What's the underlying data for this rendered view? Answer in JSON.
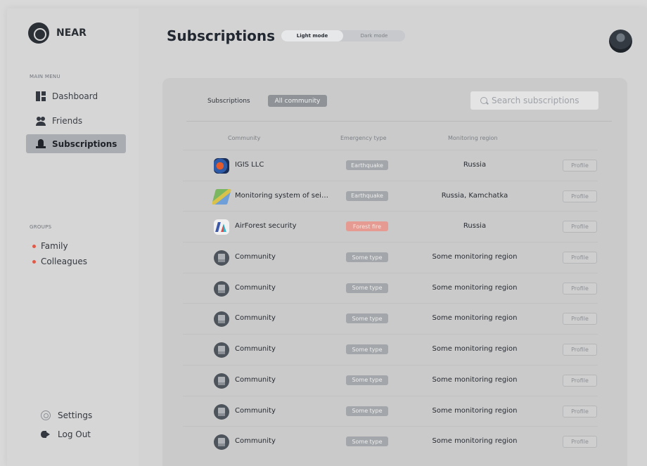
{
  "sidebar": {
    "logo_text": "NEAR",
    "main_menu_heading": "MAIN MENU",
    "menu": [
      {
        "label": "Dashboard",
        "icon": "dashboard-icon"
      },
      {
        "label": "Friends",
        "icon": "friends-icon"
      },
      {
        "label": "Subscriptions",
        "icon": "subscriptions-icon",
        "active": true
      }
    ],
    "groups_heading": "GROUPS",
    "groups": [
      {
        "label": "Family",
        "color": "#e05a47"
      },
      {
        "label": "Colleagues",
        "color": "#e05a47"
      }
    ],
    "settings_label": "Settings",
    "logout_label": "Log Out"
  },
  "header": {
    "title": "Subscriptions",
    "mode_light": "Light mode",
    "mode_dark": "Dark mode",
    "active_mode": "Light mode"
  },
  "panel": {
    "filter_label": "Subscriptions",
    "filter_chip": "All community",
    "search_placeholder": "Search subscriptions",
    "columns": {
      "community": "Community",
      "emergency_type": "Emergency type",
      "monitoring_region": "Monitoring region"
    },
    "rows": [
      {
        "name": "IGIS LLC",
        "type": "Earthquake",
        "region": "Russia",
        "button": "Profile",
        "icon": "igis-logo-icon"
      },
      {
        "name": "Monitoring system of seis...",
        "type": "Earthquake",
        "region": "Russia, Kamchatka",
        "button": "Profile",
        "icon": "seismic-map-icon"
      },
      {
        "name": "AirForest security",
        "type": "Forest fire",
        "region": "Russia",
        "button": "Profile",
        "icon": "airforest-logo-icon"
      },
      {
        "name": "Community",
        "type": "Some type",
        "region": "Some monitoring region",
        "button": "Profile",
        "icon": "community-icon"
      },
      {
        "name": "Community",
        "type": "Some type",
        "region": "Some monitoring region",
        "button": "Profile",
        "icon": "community-icon"
      },
      {
        "name": "Community",
        "type": "Some type",
        "region": "Some monitoring region",
        "button": "Profile",
        "icon": "community-icon"
      },
      {
        "name": "Community",
        "type": "Some type",
        "region": "Some monitoring region",
        "button": "Profile",
        "icon": "community-icon"
      },
      {
        "name": "Community",
        "type": "Some type",
        "region": "Some monitoring region",
        "button": "Profile",
        "icon": "community-icon"
      },
      {
        "name": "Community",
        "type": "Some type",
        "region": "Some monitoring region",
        "button": "Profile",
        "icon": "community-icon"
      },
      {
        "name": "Community",
        "type": "Some type",
        "region": "Some monitoring region",
        "button": "Profile",
        "icon": "community-icon"
      }
    ]
  },
  "colors": {
    "accent_dot": "#e05a47",
    "fire_badge": "#e59b91",
    "active_menu": "#a9acb0"
  }
}
